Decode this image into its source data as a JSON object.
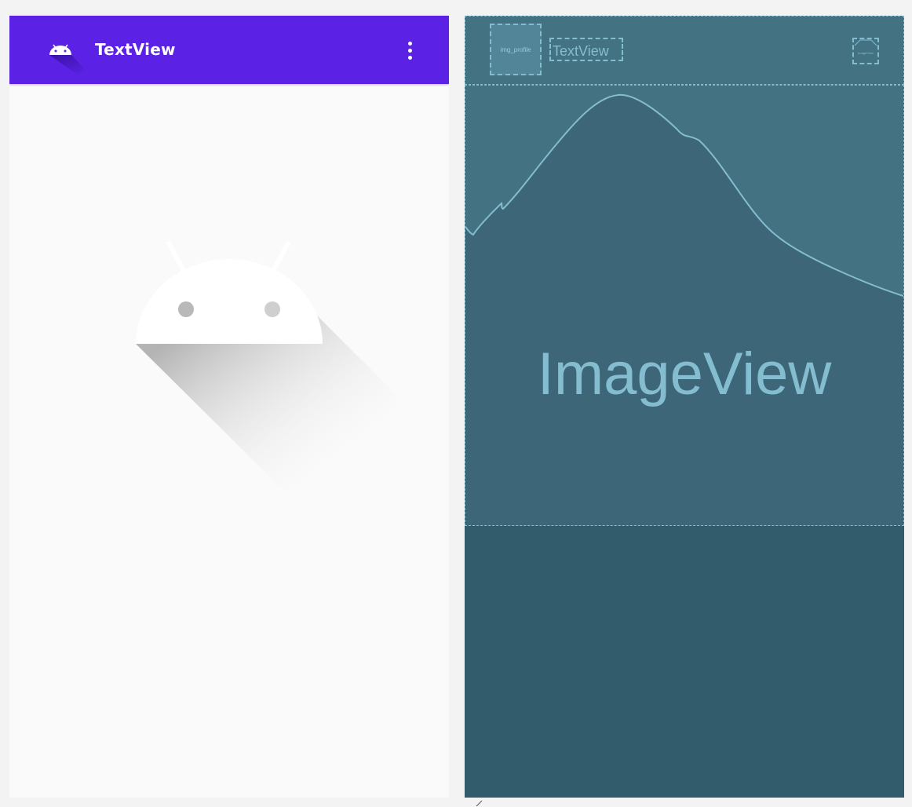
{
  "design_view": {
    "app_bar": {
      "title": "TextView",
      "logo_icon": "android-logo-icon",
      "overflow_icon": "more-vert-icon",
      "background_color": "#5b22e6"
    },
    "body": {
      "image_icon": "android-placeholder-icon",
      "background_color": "#fafafa"
    }
  },
  "blueprint_view": {
    "background_color": "#325b6c",
    "accent_color": "#84bcd0",
    "header": {
      "profile_label": "img_profile",
      "textview_label": "TextView",
      "small_image_label": "ImageView"
    },
    "image_view": {
      "label": "ImageView"
    }
  }
}
